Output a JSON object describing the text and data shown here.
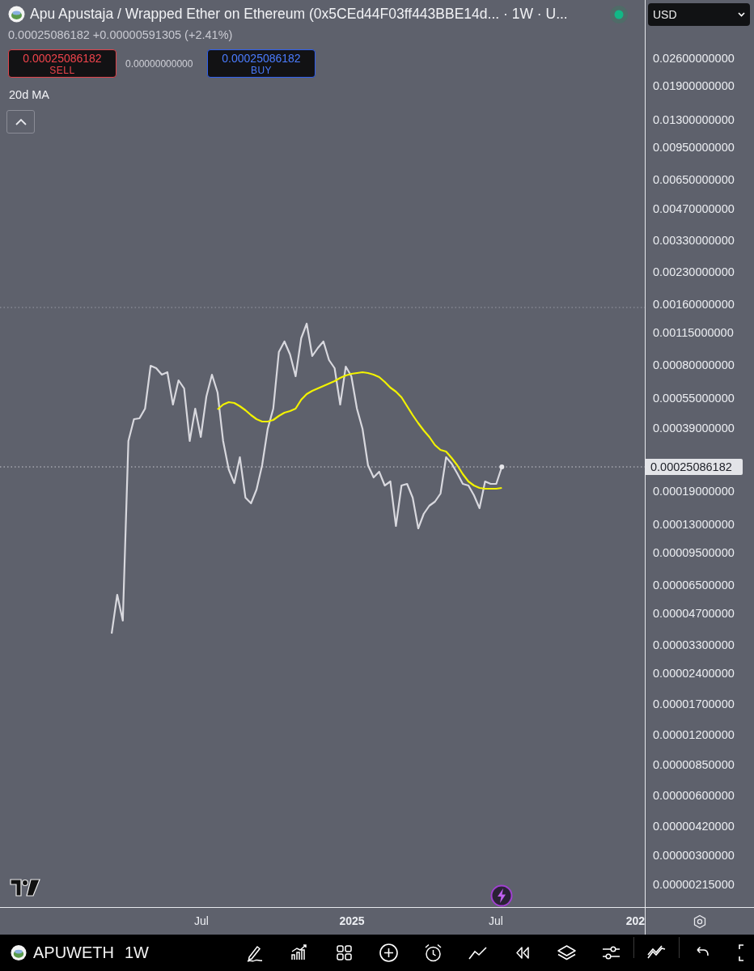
{
  "header": {
    "title": "Apu Apustaja / Wrapped Ether on Ethereum (0x5CEd44F03ff443BBE14d... · 1W · U...",
    "price": "0.00025086182",
    "change": "+0.00000591305 (+2.41%)",
    "sell": {
      "price": "0.00025086182",
      "label": "SELL"
    },
    "spread": "0.00000000000",
    "buy": {
      "price": "0.00025086182",
      "label": "BUY"
    },
    "indicator": "20d MA"
  },
  "currency": "USD",
  "price_axis": {
    "labels": [
      "0.02600000000",
      "0.01900000000",
      "0.01300000000",
      "0.00950000000",
      "0.00650000000",
      "0.00470000000",
      "0.00330000000",
      "0.00230000000",
      "0.00160000000",
      "0.00115000000",
      "0.00080000000",
      "0.00055000000",
      "0.00039000000",
      "0.00019000000",
      "0.00013000000",
      "0.00009500000",
      "0.00006500000",
      "0.00004700000",
      "0.00003300000",
      "0.00002400000",
      "0.00001700000",
      "0.00001200000",
      "0.00000850000",
      "0.00000600000",
      "0.00000420000",
      "0.00000300000",
      "0.00000215000"
    ],
    "last_price": "0.00025086182"
  },
  "time_axis": {
    "labels": [
      {
        "label": "Jul",
        "major": false
      },
      {
        "label": "2025",
        "major": true
      },
      {
        "label": "Jul",
        "major": false
      },
      {
        "label": "202",
        "major": true
      }
    ]
  },
  "toolbar": {
    "symbol": "APUWETH",
    "interval": "1W"
  }
}
